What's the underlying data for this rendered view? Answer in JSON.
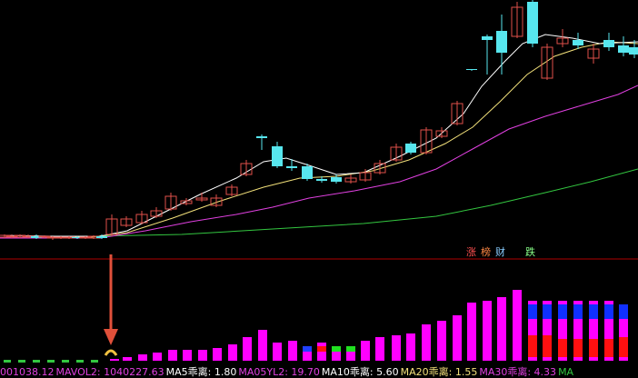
{
  "colors": {
    "background": "#000000",
    "up": "#e0504a",
    "down": "#57e6ee",
    "ma5": "#ffffff",
    "ma10": "#f2e07a",
    "ma20": "#e040e0",
    "ma60": "#33c640",
    "volume": "#ff00ff",
    "separator": "#b00000",
    "arrow": "#e0503a"
  },
  "badges": [
    {
      "text": "涨",
      "color": "#ff5050"
    },
    {
      "text": "榜",
      "color": "#ff8844"
    },
    {
      "text": "财",
      "color": "#88ccff"
    },
    {
      "text": "跌",
      "color": "#88ff88"
    }
  ],
  "legend": [
    {
      "text": "001038.12",
      "color": "#e040e0"
    },
    {
      "text": "MAVOL2: 1040227.63",
      "color": "#e040e0"
    },
    {
      "text": "MA5乖离: 1.80",
      "color": "#ffffff"
    },
    {
      "text": "MA05YL2: 19.70",
      "color": "#e040e0"
    },
    {
      "text": "MA10乖离: 5.60",
      "color": "#ffffff"
    },
    {
      "text": "MA20乖离: 1.55",
      "color": "#f2e07a"
    },
    {
      "text": "MA30乖离: 4.33",
      "color": "#e040e0"
    },
    {
      "text": "MA",
      "color": "#33c640"
    }
  ],
  "chart_data": {
    "type": "candlestick",
    "candles": [
      [
        5,
        261,
        259,
        258,
        262
      ],
      [
        13,
        261,
        260,
        258,
        262
      ],
      [
        22,
        261,
        259,
        258,
        262
      ],
      [
        31,
        261,
        260,
        258,
        262
      ],
      [
        40,
        260,
        262,
        258,
        263
      ],
      [
        49,
        261,
        260,
        259,
        262
      ],
      [
        58,
        262,
        261,
        260,
        264
      ],
      [
        67,
        262,
        261,
        260,
        263
      ],
      [
        76,
        262,
        261,
        260,
        263
      ],
      [
        85,
        261,
        262,
        260,
        263
      ],
      [
        94,
        262,
        261,
        260,
        263
      ],
      [
        103,
        262,
        260,
        259,
        263
      ],
      [
        112,
        260,
        262,
        258,
        263
      ],
      [
        123,
        258,
        241,
        236,
        260
      ],
      [
        139,
        248,
        241,
        238,
        250
      ],
      [
        156,
        245,
        236,
        232,
        247
      ],
      [
        172,
        238,
        232,
        228,
        240
      ],
      [
        188,
        230,
        216,
        212,
        232
      ],
      [
        205,
        224,
        221,
        218,
        226
      ],
      [
        222,
        220,
        218,
        212,
        222
      ],
      [
        238,
        226,
        218,
        214,
        228
      ],
      [
        255,
        214,
        206,
        203,
        216
      ],
      [
        271,
        192,
        180,
        176,
        194
      ],
      [
        288,
        150,
        152,
        148,
        165
      ],
      [
        305,
        161,
        183,
        156,
        185
      ],
      [
        321,
        183,
        185,
        175,
        188
      ],
      [
        338,
        183,
        197,
        180,
        199
      ],
      [
        354,
        197,
        199,
        194,
        201
      ],
      [
        370,
        195,
        200,
        192,
        202
      ],
      [
        386,
        200,
        196,
        192,
        202
      ],
      [
        402,
        198,
        190,
        186,
        200
      ],
      [
        418,
        190,
        180,
        176,
        192
      ],
      [
        436,
        176,
        162,
        158,
        178
      ],
      [
        452,
        158,
        168,
        156,
        170
      ],
      [
        469,
        168,
        143,
        140,
        170
      ],
      [
        486,
        150,
        144,
        140,
        152
      ],
      [
        503,
        136,
        114,
        111,
        138
      ],
      [
        519,
        76,
        77,
        76,
        78
      ],
      [
        536,
        40,
        44,
        38,
        82
      ],
      [
        552,
        34,
        58,
        16,
        82
      ],
      [
        569,
        40,
        8,
        2,
        42
      ],
      [
        586,
        2,
        48,
        0,
        52
      ],
      [
        602,
        86,
        52,
        48,
        88
      ],
      [
        619,
        48,
        42,
        32,
        52
      ],
      [
        636,
        44,
        50,
        36,
        54
      ],
      [
        653,
        64,
        54,
        48,
        70
      ],
      [
        670,
        44,
        52,
        36,
        56
      ],
      [
        686,
        50,
        58,
        40,
        62
      ],
      [
        698,
        52,
        60,
        44,
        64
      ]
    ],
    "ma5": [
      [
        0,
        259
      ],
      [
        60,
        260
      ],
      [
        110,
        260
      ],
      [
        140,
        254
      ],
      [
        180,
        234
      ],
      [
        220,
        214
      ],
      [
        260,
        196
      ],
      [
        290,
        178
      ],
      [
        315,
        174
      ],
      [
        340,
        182
      ],
      [
        370,
        192
      ],
      [
        400,
        190
      ],
      [
        440,
        172
      ],
      [
        480,
        152
      ],
      [
        510,
        125
      ],
      [
        530,
        95
      ],
      [
        555,
        68
      ],
      [
        575,
        48
      ],
      [
        600,
        38
      ],
      [
        630,
        42
      ],
      [
        660,
        48
      ],
      [
        702,
        46
      ]
    ],
    "ma10": [
      [
        0,
        261
      ],
      [
        100,
        261
      ],
      [
        140,
        256
      ],
      [
        190,
        240
      ],
      [
        240,
        222
      ],
      [
        290,
        206
      ],
      [
        330,
        196
      ],
      [
        370,
        194
      ],
      [
        410,
        188
      ],
      [
        450,
        176
      ],
      [
        490,
        158
      ],
      [
        520,
        140
      ],
      [
        550,
        112
      ],
      [
        580,
        82
      ],
      [
        610,
        62
      ],
      [
        640,
        52
      ],
      [
        670,
        46
      ],
      [
        702,
        48
      ]
    ],
    "ma20": [
      [
        0,
        262
      ],
      [
        110,
        262
      ],
      [
        160,
        254
      ],
      [
        210,
        244
      ],
      [
        260,
        236
      ],
      [
        300,
        228
      ],
      [
        340,
        218
      ],
      [
        390,
        210
      ],
      [
        440,
        200
      ],
      [
        480,
        186
      ],
      [
        520,
        164
      ],
      [
        560,
        142
      ],
      [
        600,
        128
      ],
      [
        640,
        116
      ],
      [
        680,
        104
      ],
      [
        702,
        94
      ]
    ],
    "ma60": [
      [
        0,
        262
      ],
      [
        200,
        258
      ],
      [
        300,
        252
      ],
      [
        400,
        246
      ],
      [
        480,
        238
      ],
      [
        540,
        226
      ],
      [
        600,
        212
      ],
      [
        650,
        200
      ],
      [
        702,
        186
      ]
    ],
    "volume": [
      [
        126,
        2
      ],
      [
        140,
        4
      ],
      [
        157,
        7
      ],
      [
        173,
        9
      ],
      [
        190,
        12
      ],
      [
        206,
        12
      ],
      [
        223,
        12
      ],
      [
        239,
        14
      ],
      [
        256,
        18
      ],
      [
        272,
        26
      ],
      [
        289,
        34
      ],
      [
        305,
        20
      ],
      [
        322,
        22
      ],
      [
        338,
        16
      ],
      [
        354,
        20
      ],
      [
        370,
        16
      ],
      [
        386,
        16
      ],
      [
        402,
        22
      ],
      [
        418,
        26
      ],
      [
        436,
        28
      ],
      [
        452,
        30
      ],
      [
        469,
        40
      ],
      [
        486,
        44
      ],
      [
        503,
        50
      ],
      [
        519,
        64
      ],
      [
        536,
        66
      ],
      [
        552,
        70
      ],
      [
        569,
        78
      ],
      [
        586,
        66
      ],
      [
        602,
        66
      ],
      [
        619,
        66
      ],
      [
        636,
        66
      ],
      [
        653,
        66
      ],
      [
        670,
        66
      ],
      [
        686,
        60
      ]
    ],
    "volume_lower": [
      [
        586,
        28
      ],
      [
        602,
        28
      ],
      [
        619,
        24
      ],
      [
        636,
        24
      ],
      [
        653,
        24
      ],
      [
        670,
        24
      ],
      [
        686,
        26
      ]
    ]
  }
}
